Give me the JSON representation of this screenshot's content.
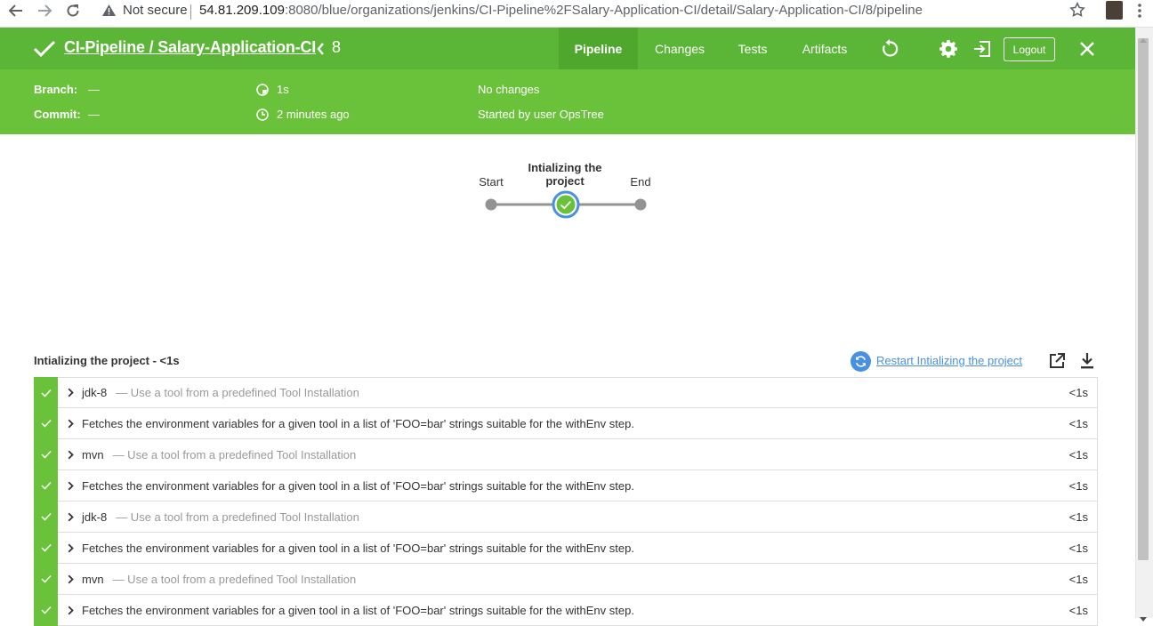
{
  "browser": {
    "security_label": "Not secure",
    "url_host": "54.81.209.109",
    "url_rest": ":8080/blue/organizations/jenkins/CI-Pipeline%2FSalary-Application-CI/detail/Salary-Application-CI/8/pipeline"
  },
  "header": {
    "title": "CI-Pipeline / Salary-Application-CI",
    "run_number": "8",
    "tabs": [
      {
        "label": "Pipeline",
        "active": true
      },
      {
        "label": "Changes",
        "active": false
      },
      {
        "label": "Tests",
        "active": false
      },
      {
        "label": "Artifacts",
        "active": false
      }
    ],
    "logout_label": "Logout",
    "status_color": "#6ac13a"
  },
  "meta": {
    "branch_label": "Branch:",
    "branch_value": "—",
    "commit_label": "Commit:",
    "commit_value": "—",
    "duration": "1s",
    "time_ago": "2 minutes ago",
    "changes": "No changes",
    "started_by": "Started by user OpsTree"
  },
  "graph": {
    "nodes": [
      {
        "label": "Start"
      },
      {
        "label_line1": "Intializing the",
        "label_line2": "project"
      },
      {
        "label": "End"
      }
    ]
  },
  "stage": {
    "title": "Intializing the project - <1s",
    "restart_label": "Restart Intializing the project"
  },
  "steps": [
    {
      "name": "jdk-8",
      "desc": "— Use a tool from a predefined Tool Installation",
      "duration": "<1s"
    },
    {
      "name": "Fetches the environment variables for a given tool in a list of 'FOO=bar' strings suitable for the withEnv step.",
      "desc": "",
      "duration": "<1s"
    },
    {
      "name": "mvn",
      "desc": "— Use a tool from a predefined Tool Installation",
      "duration": "<1s"
    },
    {
      "name": "Fetches the environment variables for a given tool in a list of 'FOO=bar' strings suitable for the withEnv step.",
      "desc": "",
      "duration": "<1s"
    },
    {
      "name": "jdk-8",
      "desc": "— Use a tool from a predefined Tool Installation",
      "duration": "<1s"
    },
    {
      "name": "Fetches the environment variables for a given tool in a list of 'FOO=bar' strings suitable for the withEnv step.",
      "desc": "",
      "duration": "<1s"
    },
    {
      "name": "mvn",
      "desc": "— Use a tool from a predefined Tool Installation",
      "duration": "<1s"
    },
    {
      "name": "Fetches the environment variables for a given tool in a list of 'FOO=bar' strings suitable for the withEnv step.",
      "desc": "",
      "duration": "<1s"
    }
  ]
}
